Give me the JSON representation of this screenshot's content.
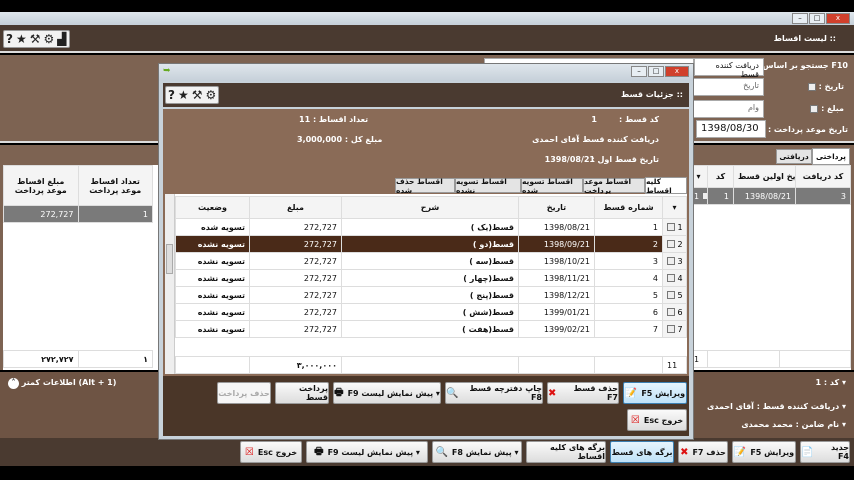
{
  "main": {
    "title": "::  لیست اقساط",
    "search": {
      "label": "F10 جستجو بر اساس :",
      "value": "دریافت کننده قسط"
    },
    "date_filter": {
      "label": "تاریخ :",
      "placeholder": "تاریخ"
    },
    "amount_filter": {
      "label": "مبلغ :",
      "placeholder": "وام"
    },
    "due_date": {
      "label": "تاریخ موعد پرداخت :",
      "value": "1398/08/30"
    },
    "tabs": [
      "پرداختی",
      "دریافتی"
    ],
    "right_columns": [
      "کد",
      "تاریخ اولین قسط",
      "کد دریافت"
    ],
    "left_columns": [
      "تعداد اقساط موعد پرداخت",
      "مبلغ اقساط موعد پرداخت"
    ],
    "row": {
      "index": "1",
      "code": "1",
      "first_date": "1398/08/21",
      "receive_code": "3",
      "due_count": "1",
      "due_amount": "272,727"
    },
    "footer": {
      "count": "1",
      "due_count": "۱",
      "due_amount": "۲۷۲,۷۲۷"
    },
    "less_info": "اطلاعات کمتر (Alt + 1)",
    "details": [
      {
        "label": "کد :",
        "value": "1"
      },
      {
        "label": "دریافت کننده قسط :",
        "value": "آقای احمدی"
      },
      {
        "label": "نام ضامن :",
        "value": "محمد محمدی"
      }
    ],
    "buttons": [
      "جدید F4",
      "ویرایش F5",
      "حذف F7",
      "برگه های قسط",
      "برگه های کلیه اقساط",
      "پیش نمایش F8",
      "پیش نمایش لیست F9",
      "خروج Esc"
    ]
  },
  "dialog": {
    "title": "::  جزئیات قسط",
    "info": {
      "code": {
        "label": "کد قسط :",
        "value": "1"
      },
      "receiver": {
        "label": "دریافت کننده قسط :",
        "value": "آقای احمدی"
      },
      "first_date": {
        "label": "تاریخ قسط اول :",
        "value": "1398/08/21"
      },
      "count": {
        "label": "تعداد اقساط :",
        "value": "11"
      },
      "total": {
        "label": "مبلغ کل :",
        "value": "3,000,000"
      }
    },
    "tabs": [
      "کلیه اقساط",
      "اقساط موعد پرداخت",
      "اقساط تسویه شده",
      "اقساط تسویه نشده",
      "اقساط حذف شده"
    ],
    "columns": [
      "شماره قسط",
      "تاریخ",
      "شرح",
      "مبلغ",
      "وضعیت"
    ],
    "rows": [
      {
        "n": "1",
        "date": "1398/08/21",
        "desc": "قسط(یک )",
        "amount": "272,727",
        "status": "تسویه شده"
      },
      {
        "n": "2",
        "date": "1398/09/21",
        "desc": "قسط(دو )",
        "amount": "272,727",
        "status": "تسویه نشده"
      },
      {
        "n": "3",
        "date": "1398/10/21",
        "desc": "قسط(سه )",
        "amount": "272,727",
        "status": "تسویه نشده"
      },
      {
        "n": "4",
        "date": "1398/11/21",
        "desc": "قسط(چهار )",
        "amount": "272,727",
        "status": "تسویه نشده"
      },
      {
        "n": "5",
        "date": "1398/12/21",
        "desc": "قسط(پنج )",
        "amount": "272,727",
        "status": "تسویه نشده"
      },
      {
        "n": "6",
        "date": "1399/01/21",
        "desc": "قسط(شش )",
        "amount": "272,727",
        "status": "تسویه نشده"
      },
      {
        "n": "7",
        "date": "1399/02/21",
        "desc": "قسط(هفت )",
        "amount": "272,727",
        "status": "تسویه نشده"
      }
    ],
    "footer": {
      "count": "11",
      "total": "۳,۰۰۰,۰۰۰"
    },
    "buttons": [
      "ویرایش F5",
      "حذف قسط F7",
      "چاپ دفترچه قسط F8",
      "پیش نمایش لیست F9",
      "پرداخت قسط",
      "حذف پرداخت",
      "خروج Esc"
    ]
  },
  "colors": {
    "brown_dark": "#4a3a30",
    "brown_mid": "#7d6352",
    "selected_row": "#4a2a18"
  }
}
